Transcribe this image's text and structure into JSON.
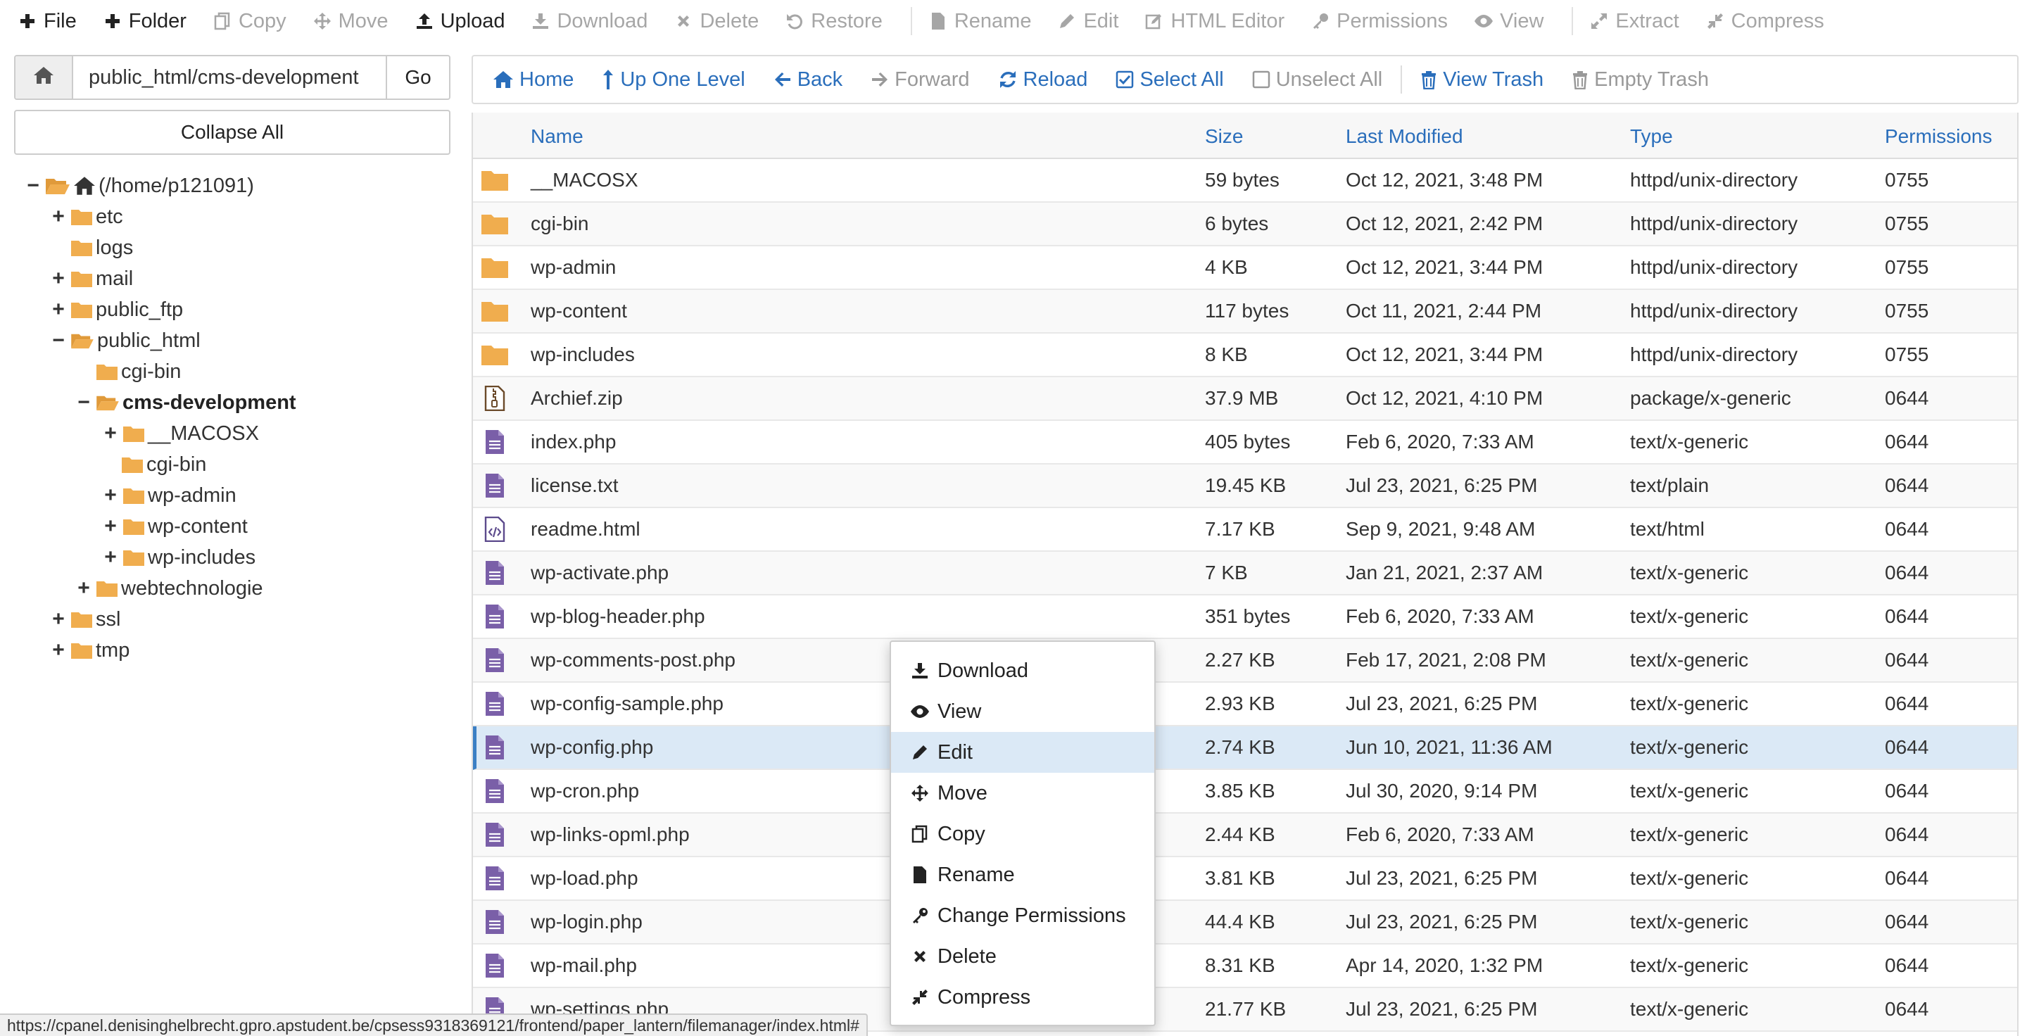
{
  "toolbar": {
    "file": "File",
    "folder": "Folder",
    "copy": "Copy",
    "move": "Move",
    "upload": "Upload",
    "download": "Download",
    "delete": "Delete",
    "restore": "Restore",
    "rename": "Rename",
    "edit": "Edit",
    "html_editor": "HTML Editor",
    "permissions": "Permissions",
    "view": "View",
    "extract": "Extract",
    "compress": "Compress"
  },
  "path": {
    "value": "public_html/cms-development",
    "go": "Go",
    "collapse_all": "Collapse All"
  },
  "tree": {
    "root": "(/home/p121091)",
    "etc": "etc",
    "logs": "logs",
    "mail": "mail",
    "public_ftp": "public_ftp",
    "public_html": "public_html",
    "cgi_bin": "cgi-bin",
    "cms_development": "cms-development",
    "macosx": "__MACOSX",
    "cgi_bin_2": "cgi-bin",
    "wp_admin": "wp-admin",
    "wp_content": "wp-content",
    "wp_includes": "wp-includes",
    "webtechnologie": "webtechnologie",
    "ssl": "ssl",
    "tmp": "tmp"
  },
  "nav": {
    "home": "Home",
    "up": "Up One Level",
    "back": "Back",
    "forward": "Forward",
    "reload": "Reload",
    "select_all": "Select All",
    "unselect_all": "Unselect All",
    "view_trash": "View Trash",
    "empty_trash": "Empty Trash"
  },
  "table": {
    "headers": {
      "name": "Name",
      "size": "Size",
      "modified": "Last Modified",
      "type": "Type",
      "perms": "Permissions"
    },
    "rows": [
      {
        "icon": "folder",
        "name": "__MACOSX",
        "size": "59 bytes",
        "modified": "Oct 12, 2021, 3:48 PM",
        "type": "httpd/unix-directory",
        "perms": "0755"
      },
      {
        "icon": "folder",
        "name": "cgi-bin",
        "size": "6 bytes",
        "modified": "Oct 12, 2021, 2:42 PM",
        "type": "httpd/unix-directory",
        "perms": "0755"
      },
      {
        "icon": "folder",
        "name": "wp-admin",
        "size": "4 KB",
        "modified": "Oct 12, 2021, 3:44 PM",
        "type": "httpd/unix-directory",
        "perms": "0755"
      },
      {
        "icon": "folder",
        "name": "wp-content",
        "size": "117 bytes",
        "modified": "Oct 11, 2021, 2:44 PM",
        "type": "httpd/unix-directory",
        "perms": "0755"
      },
      {
        "icon": "folder",
        "name": "wp-includes",
        "size": "8 KB",
        "modified": "Oct 12, 2021, 3:44 PM",
        "type": "httpd/unix-directory",
        "perms": "0755"
      },
      {
        "icon": "zip",
        "name": "Archief.zip",
        "size": "37.9 MB",
        "modified": "Oct 12, 2021, 4:10 PM",
        "type": "package/x-generic",
        "perms": "0644"
      },
      {
        "icon": "file",
        "name": "index.php",
        "size": "405 bytes",
        "modified": "Feb 6, 2020, 7:33 AM",
        "type": "text/x-generic",
        "perms": "0644"
      },
      {
        "icon": "file",
        "name": "license.txt",
        "size": "19.45 KB",
        "modified": "Jul 23, 2021, 6:25 PM",
        "type": "text/plain",
        "perms": "0644"
      },
      {
        "icon": "html",
        "name": "readme.html",
        "size": "7.17 KB",
        "modified": "Sep 9, 2021, 9:48 AM",
        "type": "text/html",
        "perms": "0644"
      },
      {
        "icon": "file",
        "name": "wp-activate.php",
        "size": "7 KB",
        "modified": "Jan 21, 2021, 2:37 AM",
        "type": "text/x-generic",
        "perms": "0644"
      },
      {
        "icon": "file",
        "name": "wp-blog-header.php",
        "size": "351 bytes",
        "modified": "Feb 6, 2020, 7:33 AM",
        "type": "text/x-generic",
        "perms": "0644"
      },
      {
        "icon": "file",
        "name": "wp-comments-post.php",
        "size": "2.27 KB",
        "modified": "Feb 17, 2021, 2:08 PM",
        "type": "text/x-generic",
        "perms": "0644"
      },
      {
        "icon": "file",
        "name": "wp-config-sample.php",
        "size": "2.93 KB",
        "modified": "Jul 23, 2021, 6:25 PM",
        "type": "text/x-generic",
        "perms": "0644"
      },
      {
        "icon": "file",
        "name": "wp-config.php",
        "size": "2.74 KB",
        "modified": "Jun 10, 2021, 11:36 AM",
        "type": "text/x-generic",
        "perms": "0644"
      },
      {
        "icon": "file",
        "name": "wp-cron.php",
        "size": "3.85 KB",
        "modified": "Jul 30, 2020, 9:14 PM",
        "type": "text/x-generic",
        "perms": "0644"
      },
      {
        "icon": "file",
        "name": "wp-links-opml.php",
        "size": "2.44 KB",
        "modified": "Feb 6, 2020, 7:33 AM",
        "type": "text/x-generic",
        "perms": "0644"
      },
      {
        "icon": "file",
        "name": "wp-load.php",
        "size": "3.81 KB",
        "modified": "Jul 23, 2021, 6:25 PM",
        "type": "text/x-generic",
        "perms": "0644"
      },
      {
        "icon": "file",
        "name": "wp-login.php",
        "size": "44.4 KB",
        "modified": "Jul 23, 2021, 6:25 PM",
        "type": "text/x-generic",
        "perms": "0644"
      },
      {
        "icon": "file",
        "name": "wp-mail.php",
        "size": "8.31 KB",
        "modified": "Apr 14, 2020, 1:32 PM",
        "type": "text/x-generic",
        "perms": "0644"
      },
      {
        "icon": "file",
        "name": "wp-settings.php",
        "size": "21.77 KB",
        "modified": "Jul 23, 2021, 6:25 PM",
        "type": "text/x-generic",
        "perms": "0644"
      }
    ]
  },
  "context_menu": {
    "download": "Download",
    "view": "View",
    "edit": "Edit",
    "move": "Move",
    "copy": "Copy",
    "rename": "Rename",
    "change_permissions": "Change Permissions",
    "delete": "Delete",
    "compress": "Compress"
  },
  "status_url": "https://cpanel.denisinghelbrecht.gpro.apstudent.be/cpsess9318369121/frontend/paper_lantern/filemanager/index.html#",
  "colors": {
    "link": "#2a6ebb",
    "folder": "#f0ad4e",
    "file": "#7a5fa8",
    "selected_row": "#dbe9f6"
  }
}
